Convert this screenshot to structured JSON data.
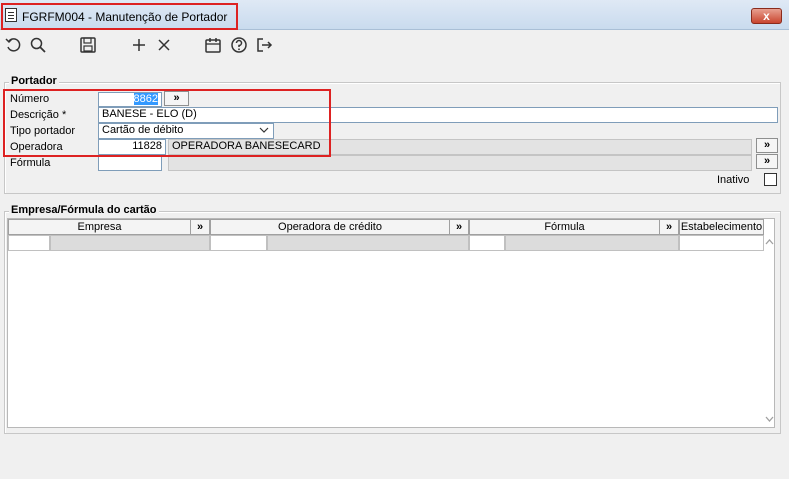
{
  "window": {
    "title": "FGRFM004 - Manutenção de Portador",
    "close_label": "x"
  },
  "toolbar": {
    "icons": [
      "undo-icon",
      "search-icon",
      "save-icon",
      "add-icon",
      "delete-icon",
      "calendar-icon",
      "help-icon",
      "exit-icon"
    ]
  },
  "portador": {
    "group_title": "Portador",
    "numero_label": "Número",
    "numero_value": "8862",
    "descricao_label": "Descrição *",
    "descricao_value": "BANESE - ELO (D)",
    "tipo_label": "Tipo portador",
    "tipo_value": "Cartão de débito",
    "operadora_label": "Operadora",
    "operadora_code": "11828",
    "operadora_name": "OPERADORA BANESECARD",
    "formula_label": "Fórmula",
    "formula_value": "",
    "inativo_label": "Inativo",
    "lookup_label": "»"
  },
  "empresa_formula": {
    "group_title": "Empresa/Fórmula do cartão",
    "columns": [
      "Empresa",
      "Operadora de crédito",
      "Fórmula",
      "Estabelecimento"
    ],
    "lookup_label": "»"
  }
}
